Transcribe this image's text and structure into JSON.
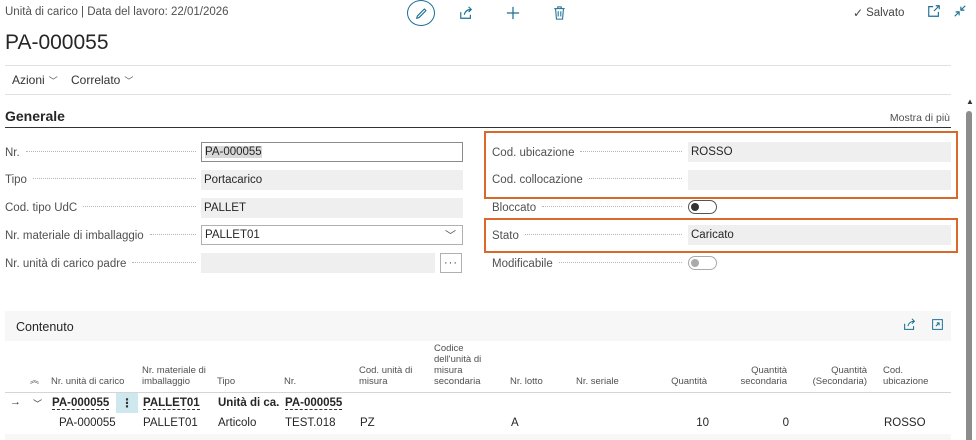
{
  "header": {
    "breadcrumb": "Unità di carico | Data del lavoro: 22/01/2026",
    "title": "PA-000055",
    "saved_label": "Salvato"
  },
  "actions": {
    "azioni": "Azioni",
    "correlato": "Correlato"
  },
  "generale": {
    "title": "Generale",
    "show_more": "Mostra di più",
    "left_fields": [
      {
        "label": "Nr.",
        "value": "PA-000055"
      },
      {
        "label": "Tipo",
        "value": "Portacarico"
      },
      {
        "label": "Cod. tipo UdC",
        "value": "PALLET"
      },
      {
        "label": "Nr. materiale di imballaggio",
        "value": "PALLET01"
      },
      {
        "label": "Nr. unità di carico padre",
        "value": ""
      }
    ],
    "right_fields": [
      {
        "label": "Cod. ubicazione",
        "value": "ROSSO"
      },
      {
        "label": "Cod. collocazione",
        "value": ""
      },
      {
        "label": "Bloccato",
        "toggle": false
      },
      {
        "label": "Stato",
        "value": "Caricato"
      },
      {
        "label": "Modificabile",
        "toggle": false
      }
    ],
    "lookup_label": "···"
  },
  "contenuto": {
    "title": "Contenuto",
    "columns": [
      "Nr. unità di carico",
      "Nr. materiale di imballaggio",
      "Tipo",
      "Nr.",
      "Cod. unità di misura",
      "Codice dell'unità di misura secondaria",
      "Nr. lotto",
      "Nr. seriale",
      "Quantità",
      "Quantità secondaria",
      "Quantità (Secondaria)",
      "Cod. ubicazione"
    ],
    "rows": [
      {
        "unit": "PA-000055",
        "material": "PALLET01",
        "type": "Unità di ca...",
        "no": "PA-000055",
        "uom": "",
        "uom2": "",
        "lot": "",
        "serial": "",
        "qty": "",
        "qty2": "",
        "qty3": "",
        "location": ""
      },
      {
        "unit": "PA-000055",
        "material": "PALLET01",
        "type": "Articolo",
        "no": "TEST.018",
        "uom": "PZ",
        "uom2": "",
        "lot": "A",
        "serial": "",
        "qty": "10",
        "qty2": "0",
        "qty3": "",
        "location": "ROSSO"
      }
    ]
  },
  "colors": {
    "accent": "#1a6f93",
    "highlight": "#d9692a",
    "field_bg": "#efefef"
  }
}
